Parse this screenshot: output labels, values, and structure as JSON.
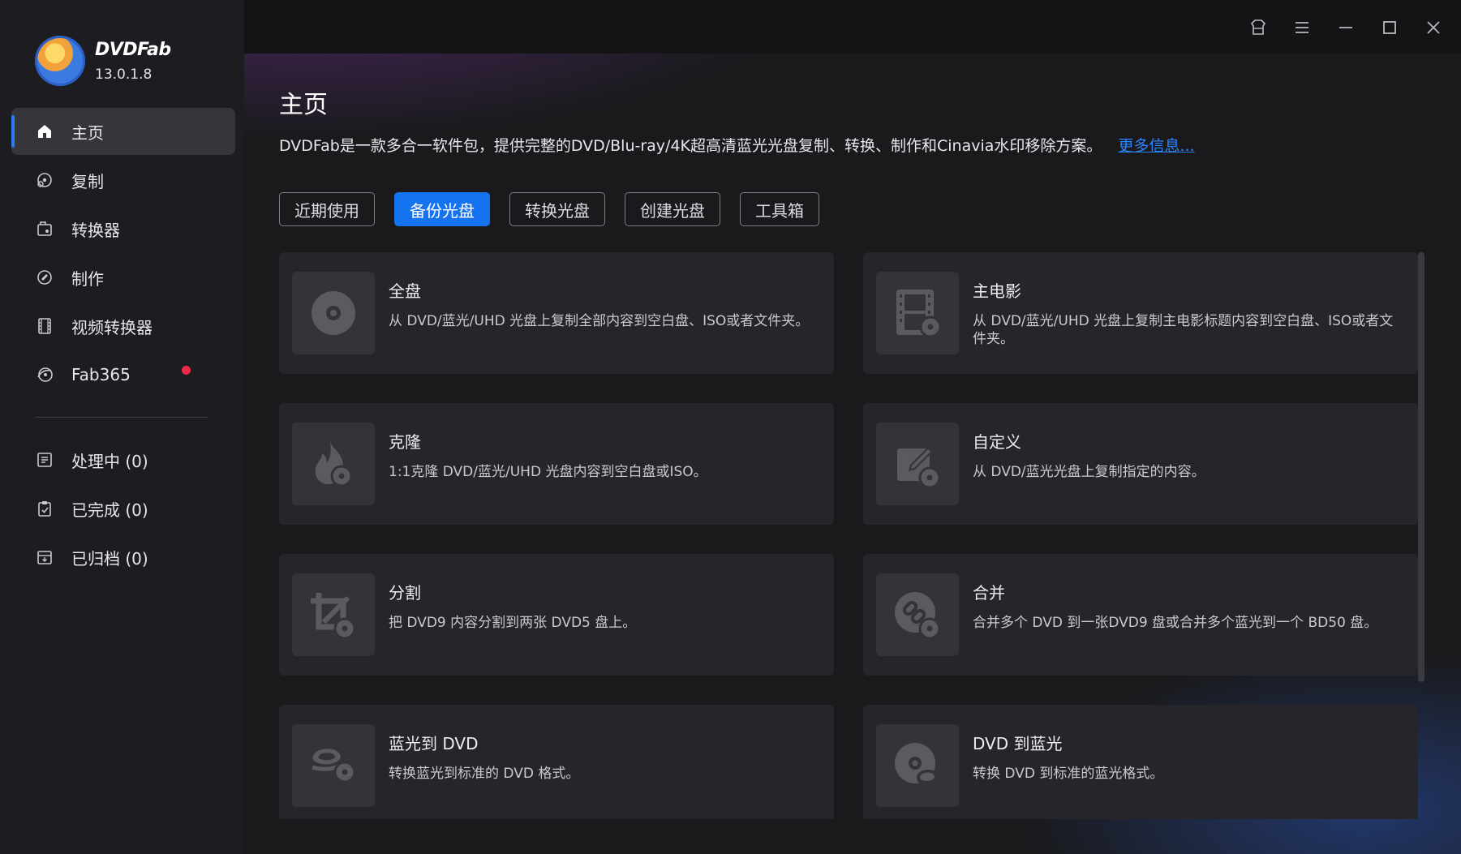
{
  "brand": {
    "name": "DVDFab",
    "version": "13.0.1.8"
  },
  "sidebar": {
    "nav": [
      {
        "label": "主页",
        "icon": "home-icon"
      },
      {
        "label": "复制",
        "icon": "copy-disc-icon"
      },
      {
        "label": "转换器",
        "icon": "converter-icon"
      },
      {
        "label": "制作",
        "icon": "creator-disc-icon"
      },
      {
        "label": "视频转换器",
        "icon": "film-icon"
      },
      {
        "label": "Fab365",
        "icon": "fab365-icon"
      }
    ],
    "queue": [
      {
        "label": "处理中 (0)",
        "icon": "processing-list-icon"
      },
      {
        "label": "已完成 (0)",
        "icon": "completed-clipboard-icon"
      },
      {
        "label": "已归档 (0)",
        "icon": "archive-box-icon"
      }
    ]
  },
  "window": {
    "controls": [
      "skin-icon",
      "menu-icon",
      "minimize-icon",
      "maximize-icon",
      "close-icon"
    ]
  },
  "main": {
    "title": "主页",
    "description": "DVDFab是一款多合一软件包，提供完整的DVD/Blu-ray/4K超高清蓝光光盘复制、转换、制作和Cinavia水印移除方案。",
    "more_link": "更多信息...",
    "tabs": [
      "近期使用",
      "备份光盘",
      "转换光盘",
      "创建光盘",
      "工具箱"
    ],
    "active_tab": "备份光盘",
    "cards": [
      {
        "title": "全盘",
        "desc": "从 DVD/蓝光/UHD 光盘上复制全部内容到空白盘、ISO或者文件夹。",
        "icon": "full-disc-icon"
      },
      {
        "title": "主电影",
        "desc": "从 DVD/蓝光/UHD 光盘上复制主电影标题内容到空白盘、ISO或者文件夹。",
        "icon": "main-movie-film-icon"
      },
      {
        "title": "克隆",
        "desc": "1:1克隆 DVD/蓝光/UHD 光盘内容到空白盘或ISO。",
        "icon": "clone-flame-icon"
      },
      {
        "title": "自定义",
        "desc": "从 DVD/蓝光光盘上复制指定的内容。",
        "icon": "customize-pencil-icon"
      },
      {
        "title": "分割",
        "desc": "把 DVD9 内容分割到两张 DVD5 盘上。",
        "icon": "split-crop-icon"
      },
      {
        "title": "合并",
        "desc": "合并多个 DVD 到一张DVD9 盘或合并多个蓝光到一个 BD50 盘。",
        "icon": "merge-link-icon"
      },
      {
        "title": "蓝光到 DVD",
        "desc": "转换蓝光到标准的 DVD 格式。",
        "icon": "bluray-to-dvd-icon"
      },
      {
        "title": "DVD 到蓝光",
        "desc": "转换 DVD 到标准的蓝光格式。",
        "icon": "dvd-to-bluray-icon"
      }
    ]
  },
  "colors": {
    "accent": "#1673f0",
    "badge": "#ee2a4b",
    "link": "#2a86ff"
  }
}
